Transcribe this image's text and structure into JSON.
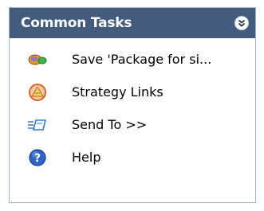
{
  "panel": {
    "title": "Common Tasks",
    "collapse_icon": "double-chevron-down-icon",
    "items": [
      {
        "label": "Save 'Package for si...",
        "icon": "save-package-icon"
      },
      {
        "label": "Strategy Links",
        "icon": "strategy-links-icon"
      },
      {
        "label": "Send To >>",
        "icon": "send-to-icon"
      },
      {
        "label": "Help",
        "icon": "help-icon"
      }
    ]
  },
  "colors": {
    "header_bg": "#435c7e",
    "header_text": "#ffffff",
    "border": "#9fb3cc"
  }
}
